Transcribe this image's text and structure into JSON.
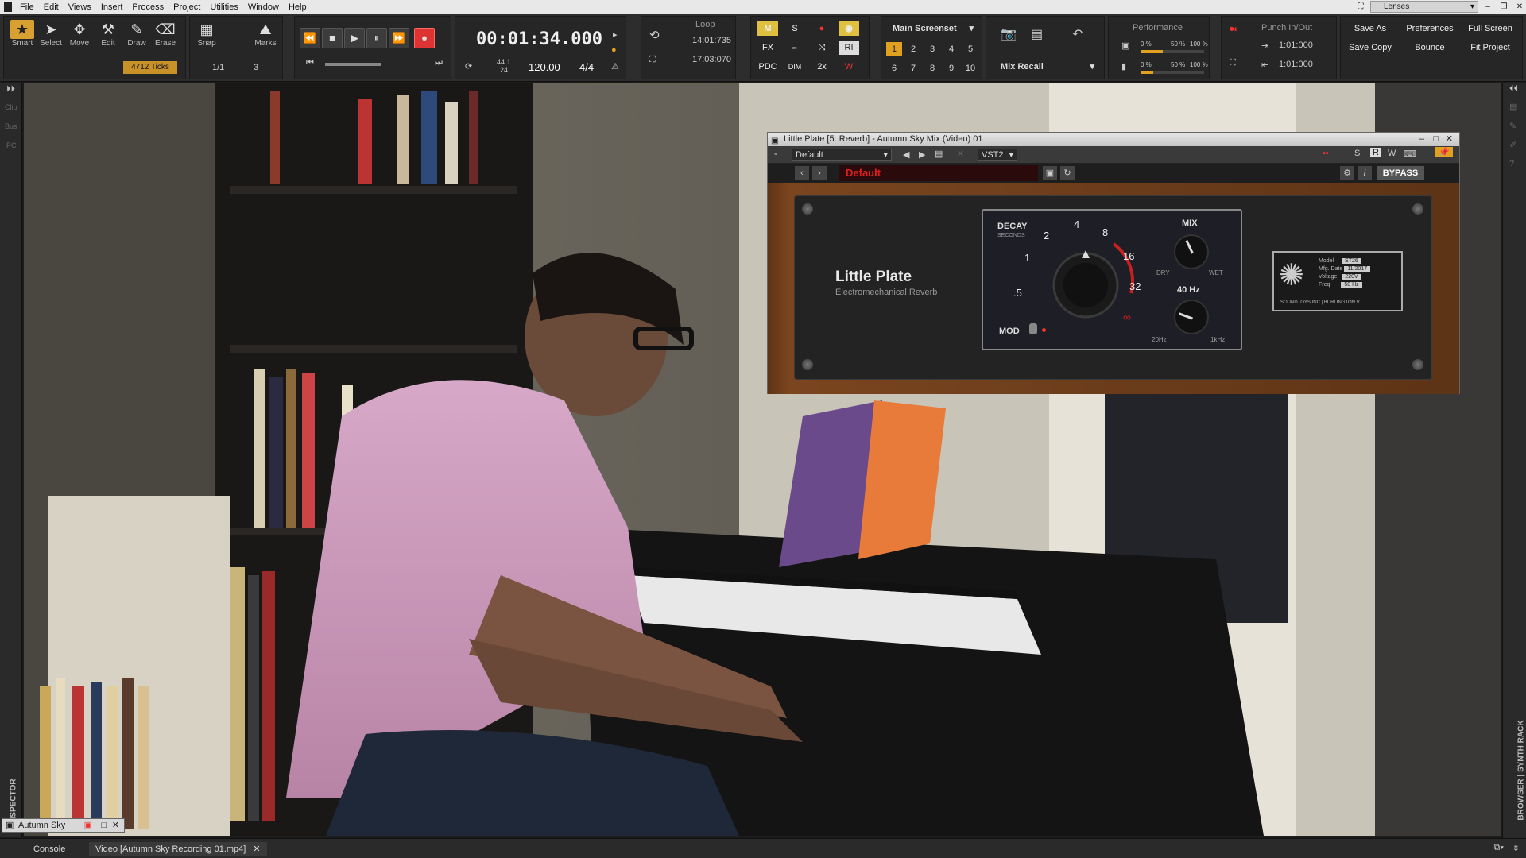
{
  "menu": [
    "File",
    "Edit",
    "Views",
    "Insert",
    "Process",
    "Project",
    "Utilities",
    "Window",
    "Help"
  ],
  "lenses": "Lenses",
  "tools": [
    {
      "label": "Smart",
      "glyph": "★"
    },
    {
      "label": "Select",
      "glyph": "➤"
    },
    {
      "label": "Move",
      "glyph": "✥"
    },
    {
      "label": "Edit",
      "glyph": "⚒"
    },
    {
      "label": "Draw",
      "glyph": "✎"
    },
    {
      "label": "Erase",
      "glyph": "⌫"
    }
  ],
  "ticks": "4712 Ticks",
  "snap": {
    "label": "Snap",
    "value": "1/1",
    "marks": "Marks",
    "by": "3"
  },
  "transport": {
    "time": "00:01:34.000",
    "sample_rate": "44.1",
    "bit_depth": "24",
    "tempo": "120.00",
    "meter": "4/4"
  },
  "loop": {
    "label": "Loop",
    "start": "14:01:735",
    "end": "17:03:070"
  },
  "mix_buttons": {
    "m": "M",
    "s": "S",
    "fx": "FX",
    "ri": "RI",
    "pdc": "PDC",
    "dim": "DIM",
    "two_x": "2x"
  },
  "screenset": {
    "label": "Main Screenset",
    "numbers": [
      "1",
      "2",
      "3",
      "4",
      "5",
      "6",
      "7",
      "8",
      "9",
      "10"
    ],
    "active": "1",
    "recall": "Mix Recall"
  },
  "performance": {
    "label": "Performance",
    "cpu_pct": "0 %",
    "cpu_a": "50 %",
    "cpu_b": "100 %",
    "cpu_level": 0.35,
    "disk_pct": "0 %",
    "disk_a": "50 %",
    "disk_b": "100 %",
    "disk_level": 0.2
  },
  "punch": {
    "label": "Punch In/Out",
    "in": "1:01:000",
    "out": "1:01:000"
  },
  "right_buttons": [
    "Save As",
    "Preferences",
    "Full Screen",
    "Save Copy",
    "Bounce",
    "Fit Project"
  ],
  "left_strip": [
    "Clip",
    "Bus",
    "PC"
  ],
  "right_strip_label": "BROWSER | SYNTH RACK",
  "inspector_label": "INSPECTOR",
  "plugin": {
    "title": "Little Plate [5: Reverb] - Autumn Sky Mix (Video) 01",
    "preset_dd": "Default",
    "format": "VST2",
    "s": "S",
    "r": "R",
    "w": "W",
    "preset_name": "Default",
    "bypass": "BYPASS",
    "name": "Little Plate",
    "subtitle": "Electromechanical Reverb",
    "decay_label": "DECAY",
    "decay_unit": "SECONDS",
    "decay_ticks": [
      ".5",
      "1",
      "2",
      "4",
      "8",
      "16",
      "32",
      "∞"
    ],
    "mix_label": "MIX",
    "dry": "DRY",
    "wet": "WET",
    "hp_label": "40 Hz",
    "hp_low": "20Hz",
    "hp_high": "1kHz",
    "mod": "MOD",
    "badge": {
      "rows": [
        [
          "Model",
          "ST26"
        ],
        [
          "Mfg. Date",
          "11/2017"
        ],
        [
          "Voltage",
          "220V"
        ],
        [
          "Freq",
          "50 Hz"
        ]
      ],
      "footer": "SOUNDTOYS INC | BURLINGTON VT"
    }
  },
  "mini_window": "Autumn Sky",
  "bottom_tabs": [
    "Console",
    "Video [Autumn Sky Recording 01.mp4]"
  ]
}
